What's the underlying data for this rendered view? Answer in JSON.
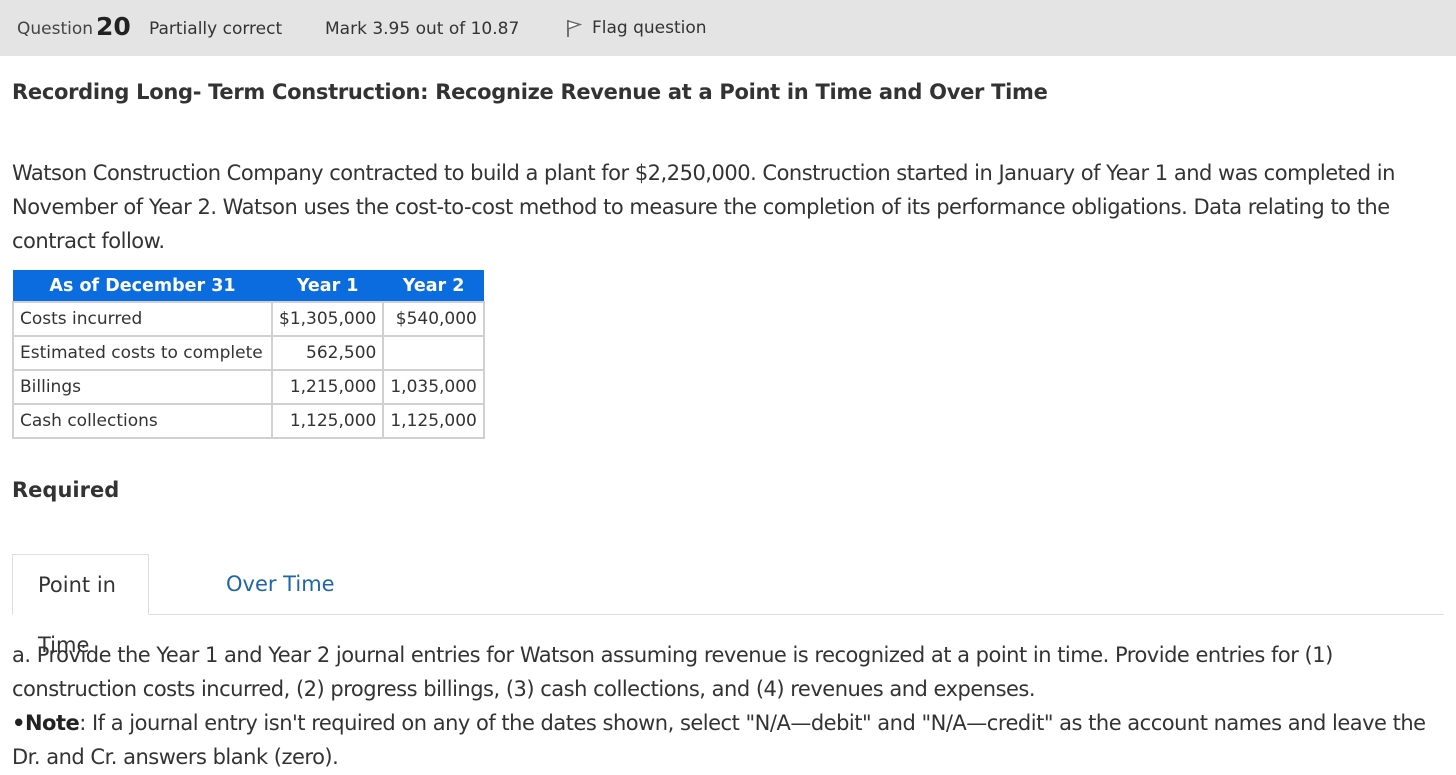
{
  "header": {
    "question_label": "Question",
    "question_number": "20",
    "status": "Partially correct",
    "mark": "Mark 3.95 out of 10.87",
    "flag_label": "Flag question"
  },
  "title": "Recording Long- Term Construction: Recognize Revenue at a Point in Time and Over Time",
  "intro": "Watson Construction Company contracted to build a plant for $2,250,000. Construction started in January of Year 1 and was completed in November of Year 2. Watson uses the cost-to-cost method to measure the completion of its performance obligations. Data relating to the contract follow.",
  "table": {
    "headers": [
      "As of December 31",
      "Year 1",
      "Year 2"
    ],
    "rows": [
      {
        "label": "Costs incurred",
        "year1": "$1,305,000",
        "year2": "$540,000"
      },
      {
        "label": "Estimated costs to complete",
        "year1": "562,500",
        "year2": ""
      },
      {
        "label": "Billings",
        "year1": "1,215,000",
        "year2": "1,035,000"
      },
      {
        "label": "Cash collections",
        "year1": "1,125,000",
        "year2": "1,125,000"
      }
    ]
  },
  "required_label": "Required",
  "tabs": [
    {
      "label": "Point in Time",
      "active": true
    },
    {
      "label": "Over Time",
      "active": false
    }
  ],
  "instructions": {
    "part_a": "a. Provide the Year 1 and Year 2 journal entries for Watson assuming revenue is recognized at a point in time. Provide entries for (1) construction costs incurred, (2) progress billings, (3) cash collections, and (4) revenues and expenses.",
    "note_bullet": "•",
    "note_label": "Note",
    "note_text": ": If a journal entry isn't required on any of the dates shown, select \"N/A—debit\" and \"N/A—credit\" as the account names and leave the Dr. and Cr. answers blank (zero)."
  },
  "colors": {
    "header_bg": "#e4e4e4",
    "table_header": "#0b6ce0",
    "link": "#1f66a8"
  }
}
